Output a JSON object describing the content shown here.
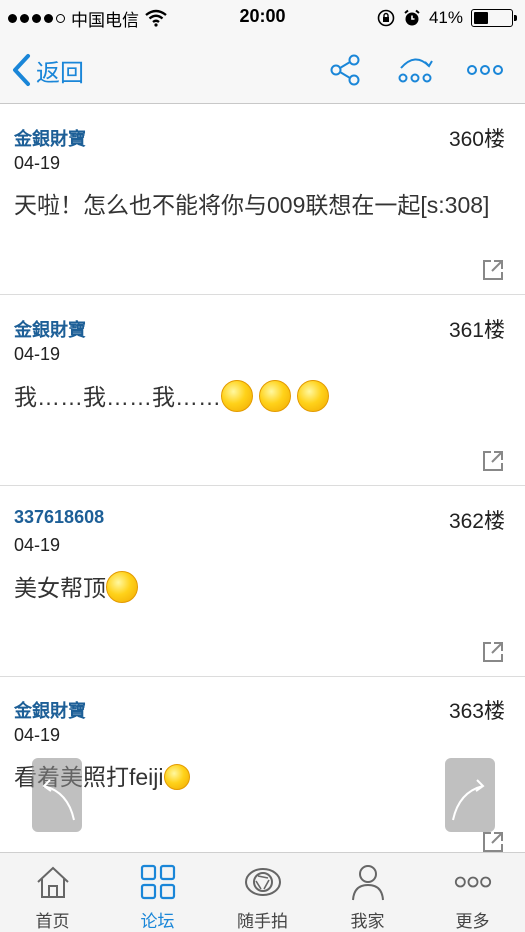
{
  "status_bar": {
    "carrier": "中国电信",
    "time": "20:00",
    "battery_percent": "41%",
    "battery_level": 0.41
  },
  "nav": {
    "back_label": "返回",
    "actions": [
      "share-icon",
      "reply-refresh-icon",
      "more-icon"
    ]
  },
  "posts": [
    {
      "author": "金銀財寶",
      "floor": "360楼",
      "date": "04-19",
      "content": "天啦！怎么也不能将你与009联想在一起[s:308]"
    },
    {
      "author": "金銀財寶",
      "floor": "361楼",
      "date": "04-19",
      "content": "我……我……我……",
      "emoji_count": 3
    },
    {
      "author": "337618608",
      "floor": "362楼",
      "date": "04-19",
      "content": "美女帮顶",
      "emoji_count": 1
    },
    {
      "author": "金銀財寶",
      "floor": "363楼",
      "date": "04-19",
      "content": "看着美照打feiji",
      "emoji_count": 1
    }
  ],
  "tabbar": {
    "items": [
      {
        "label": "首页",
        "icon": "home-icon",
        "active": false
      },
      {
        "label": "论坛",
        "icon": "forum-grid-icon",
        "active": true
      },
      {
        "label": "随手拍",
        "icon": "camera-aperture-icon",
        "active": false
      },
      {
        "label": "我家",
        "icon": "person-icon",
        "active": false
      },
      {
        "label": "更多",
        "icon": "more-icon",
        "active": false
      }
    ]
  },
  "colors": {
    "accent": "#1a86d8",
    "author": "#1d5f97"
  }
}
